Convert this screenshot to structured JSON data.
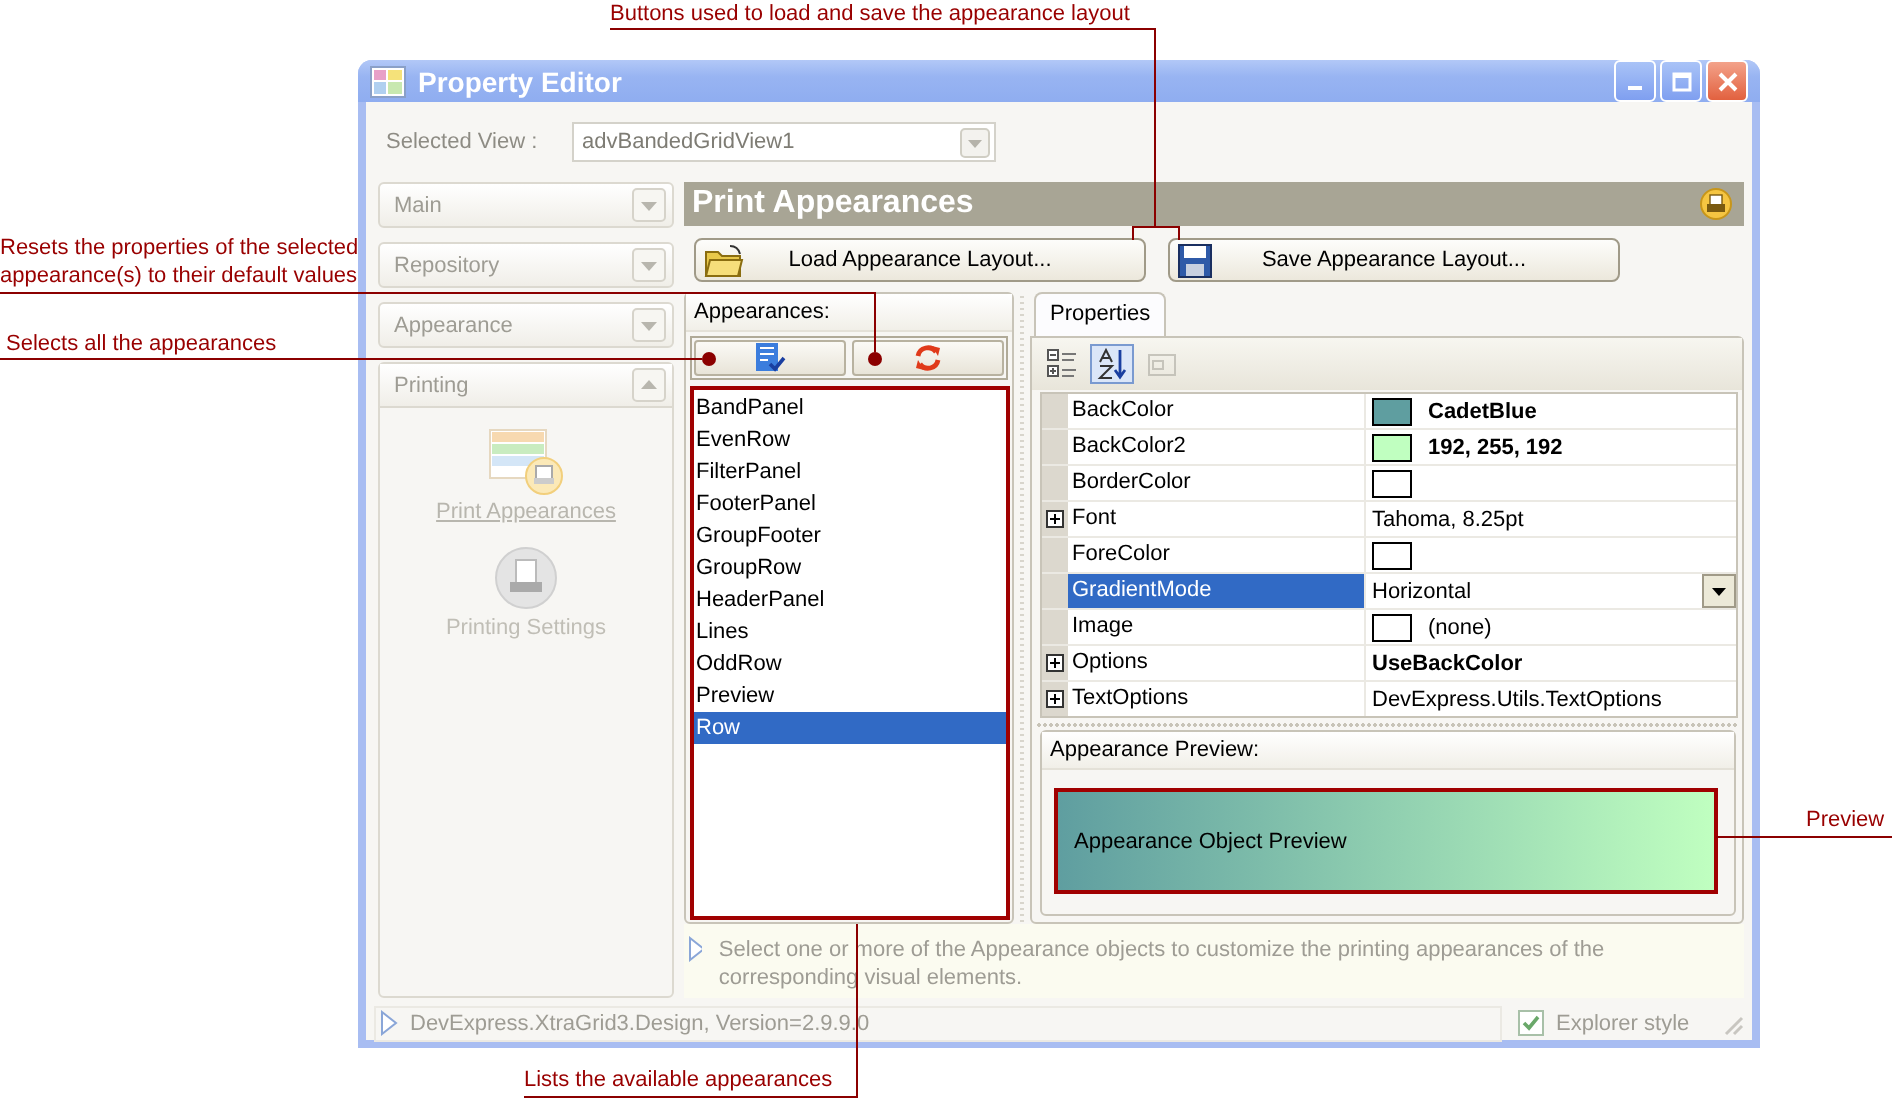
{
  "window": {
    "title": "Property Editor"
  },
  "selected_view": {
    "label": "Selected View :",
    "value": "advBandedGridView1"
  },
  "nav_groups": [
    {
      "label": "Main",
      "expanded": false
    },
    {
      "label": "Repository",
      "expanded": false
    },
    {
      "label": "Appearance",
      "expanded": false
    },
    {
      "label": "Printing",
      "expanded": true,
      "items": [
        {
          "label": "Print Appearances",
          "kind": "appearances",
          "selected": true
        },
        {
          "label": "Printing Settings",
          "kind": "settings",
          "selected": false
        }
      ]
    }
  ],
  "page": {
    "title": "Print Appearances"
  },
  "layout_buttons": [
    {
      "label": "Load Appearance Layout...",
      "kind": "load"
    },
    {
      "label": "Save Appearance Layout...",
      "kind": "save"
    }
  ],
  "appearances": {
    "header": "Appearances:",
    "tools": [
      {
        "kind": "select-all"
      },
      {
        "kind": "reset"
      }
    ],
    "items": [
      {
        "label": "BandPanel",
        "selected": false
      },
      {
        "label": "EvenRow",
        "selected": false
      },
      {
        "label": "FilterPanel",
        "selected": false
      },
      {
        "label": "FooterPanel",
        "selected": false
      },
      {
        "label": "GroupFooter",
        "selected": false
      },
      {
        "label": "GroupRow",
        "selected": false
      },
      {
        "label": "HeaderPanel",
        "selected": false
      },
      {
        "label": "Lines",
        "selected": false
      },
      {
        "label": "OddRow",
        "selected": false
      },
      {
        "label": "Preview",
        "selected": false
      },
      {
        "label": "Row",
        "selected": true
      }
    ]
  },
  "properties": {
    "tab": "Properties",
    "toolbar": [
      {
        "kind": "categorized",
        "selected": false,
        "disabled": false
      },
      {
        "kind": "alphabetical",
        "selected": true,
        "disabled": false
      },
      {
        "kind": "pages",
        "selected": false,
        "disabled": true
      }
    ],
    "rows": [
      {
        "name": "BackColor",
        "value": "CadetBlue",
        "color": "#5f9ea0",
        "bold": true,
        "expandable": false,
        "selected": false
      },
      {
        "name": "BackColor2",
        "value": "192, 255, 192",
        "color": "#c0ffc0",
        "bold": true,
        "expandable": false,
        "selected": false
      },
      {
        "name": "BorderColor",
        "color": "#ffffff",
        "expandable": false,
        "selected": false
      },
      {
        "name": "Font",
        "value": "Tahoma, 8.25pt",
        "bold": false,
        "expandable": true,
        "selected": false
      },
      {
        "name": "ForeColor",
        "color": "#ffffff",
        "expandable": false,
        "selected": false
      },
      {
        "name": "GradientMode",
        "value": "Horizontal",
        "bold": false,
        "expandable": false,
        "selected": true
      },
      {
        "name": "Image",
        "value": "(none)",
        "color": "#ffffff",
        "bold": false,
        "expandable": false,
        "selected": false
      },
      {
        "name": "Options",
        "value": "UseBackColor",
        "bold": true,
        "expandable": true,
        "selected": false
      },
      {
        "name": "TextOptions",
        "value": "DevExpress.Utils.TextOptions",
        "bold": false,
        "expandable": true,
        "selected": false
      }
    ]
  },
  "preview": {
    "header": "Appearance Preview:",
    "text": "Appearance Object Preview"
  },
  "hint": "Select one or more of the Appearance objects to customize the printing appearances of the corresponding visual elements.",
  "status_bar": {
    "text": "DevExpress.XtraGrid3.Design, Version=2.9.9.0",
    "explorer_style": {
      "label": "Explorer style",
      "checked": true
    }
  },
  "annotations": [
    "Buttons used to load and save the appearance layout",
    "Resets the properties of the selected appearance(s) to their default values",
    "Selects all the appearances",
    "Lists the available appearances",
    "Preview"
  ]
}
